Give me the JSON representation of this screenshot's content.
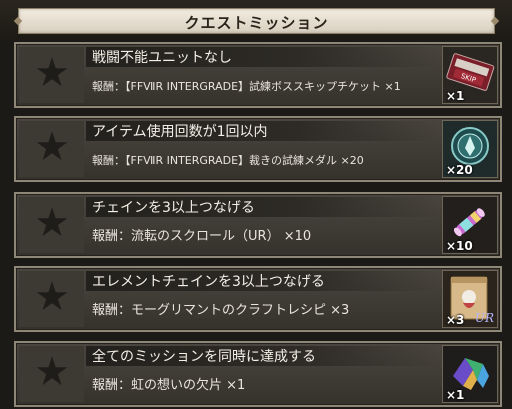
{
  "header": {
    "title": "クエストミッション"
  },
  "missions": [
    {
      "title": "戦闘不能ユニットなし",
      "reward_label": "報酬：",
      "reward": "【FFⅦR INTERGRADE】試練ボススキップチケット ×1",
      "qty": "×1",
      "icon": "skip-ticket-icon"
    },
    {
      "title": "アイテム使用回数が1回以内",
      "reward_label": "報酬：",
      "reward": "【FFⅦR INTERGRADE】裁きの試練メダル ×20",
      "qty": "×20",
      "icon": "trial-medal-icon"
    },
    {
      "title": "チェインを3以上つなげる",
      "reward_label": "報酬：",
      "reward": "流転のスクロール（UR） ×10",
      "qty": "×10",
      "icon": "scroll-icon"
    },
    {
      "title": "エレメントチェインを3以上つなげる",
      "reward_label": "報酬：",
      "reward": "モーグリマントのクラフトレシピ ×3",
      "qty": "×3",
      "icon": "recipe-icon",
      "badge": "UR"
    },
    {
      "title": "全てのミッションを同時に達成する",
      "reward_label": "報酬：",
      "reward": "虹の想いの欠片 ×1",
      "qty": "×1",
      "icon": "rainbow-shard-icon"
    }
  ],
  "colors": {
    "frame": "#8e8778",
    "panel": "#3d3a34",
    "title_plate": "#e8e1d3"
  }
}
